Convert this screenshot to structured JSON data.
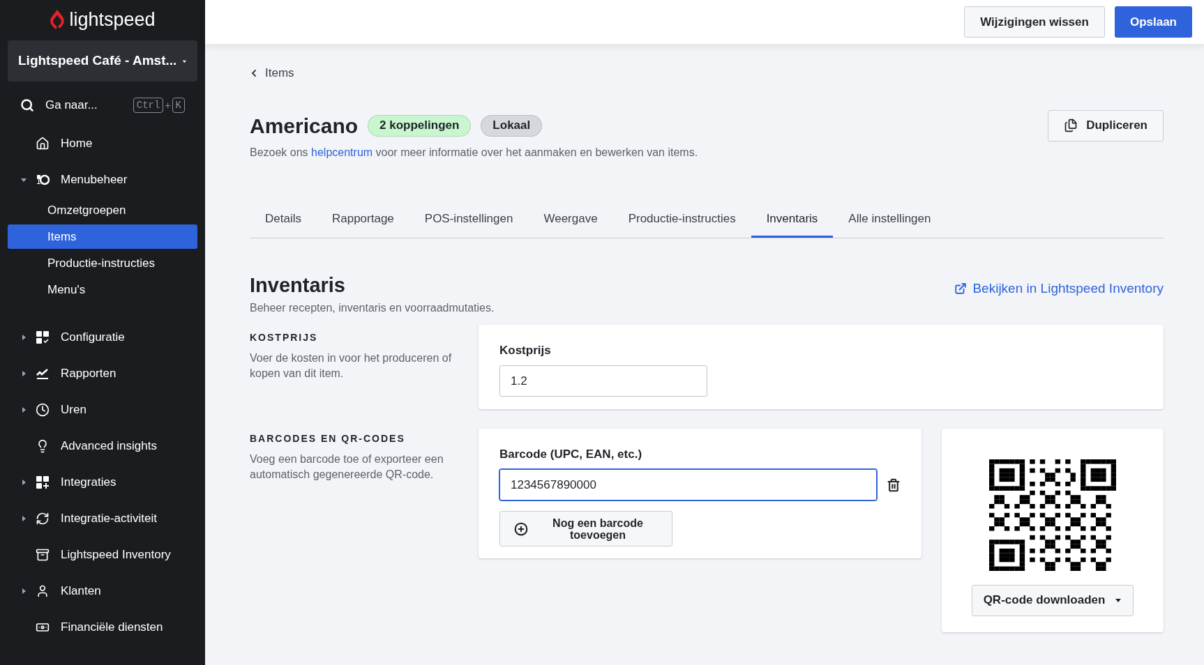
{
  "sidebar": {
    "brand": "lightspeed",
    "location": "Lightspeed Café - Amst...",
    "search": {
      "label": "Ga naar...",
      "shortcut": [
        "Ctrl",
        "+",
        "K"
      ]
    },
    "items": [
      {
        "label": "Home",
        "kind": "link"
      },
      {
        "label": "Menubeheer",
        "kind": "group",
        "expanded": true,
        "children": [
          {
            "label": "Omzetgroepen",
            "selected": false
          },
          {
            "label": "Items",
            "selected": true
          },
          {
            "label": "Productie-instructies",
            "selected": false
          },
          {
            "label": "Menu's",
            "selected": false
          }
        ]
      },
      {
        "label": "Configuratie",
        "kind": "group",
        "expanded": false
      },
      {
        "label": "Rapporten",
        "kind": "group",
        "expanded": false
      },
      {
        "label": "Uren",
        "kind": "group",
        "expanded": false
      },
      {
        "label": "Advanced insights",
        "kind": "link"
      },
      {
        "label": "Integraties",
        "kind": "group",
        "expanded": false
      },
      {
        "label": "Integratie-activiteit",
        "kind": "group",
        "expanded": false
      },
      {
        "label": "Lightspeed Inventory",
        "kind": "link"
      },
      {
        "label": "Klanten",
        "kind": "group",
        "expanded": false
      },
      {
        "label": "Financiële diensten",
        "kind": "link"
      }
    ]
  },
  "top_bar": {
    "buttons": [
      {
        "label": "Wijzigingen wissen",
        "kind": "secondary"
      },
      {
        "label": "Opslaan",
        "kind": "primary"
      }
    ]
  },
  "breadcrumb": "Items",
  "header": {
    "title": "Americano",
    "badges": [
      {
        "label": "2 koppelingen",
        "color": "#c9f5cf"
      },
      {
        "label": "Lokaal",
        "color": "#d5d8dd"
      }
    ],
    "duplicate_button": "Dupliceren",
    "help": {
      "before": "Bezoek ons",
      "link": "helpcentrum",
      "after": "voor meer informatie over het aanmaken en bewerken van items."
    }
  },
  "tabs": [
    {
      "label": "Details",
      "selected": false
    },
    {
      "label": "Rapportage",
      "selected": false
    },
    {
      "label": "POS-instellingen",
      "selected": false
    },
    {
      "label": "Weergave",
      "selected": false
    },
    {
      "label": "Productie-instructies",
      "selected": false
    },
    {
      "label": "Inventaris",
      "selected": true
    },
    {
      "label": "Alle instellingen",
      "selected": false
    }
  ],
  "section": {
    "title": "Inventaris",
    "subtitle": "Beheer recepten, inventaris en voorraadmutaties.",
    "external_link": "Bekijken in Lightspeed Inventory"
  },
  "cost": {
    "heading": "KOSTPRIJS",
    "description": "Voer de kosten in voor het produceren of kopen van dit item.",
    "field_label": "Kostprijs",
    "value": "1.2"
  },
  "barcodes": {
    "heading": "BARCODES EN QR-CODES",
    "description": "Voeg een barcode toe of exporteer een automatisch gegenereerde QR-code.",
    "field_label": "Barcode (UPC, EAN, etc.)",
    "value": "1234567890000",
    "focused": true,
    "add_button": "Nog een barcode toevoegen",
    "qr_button": "QR-code downloaden"
  }
}
